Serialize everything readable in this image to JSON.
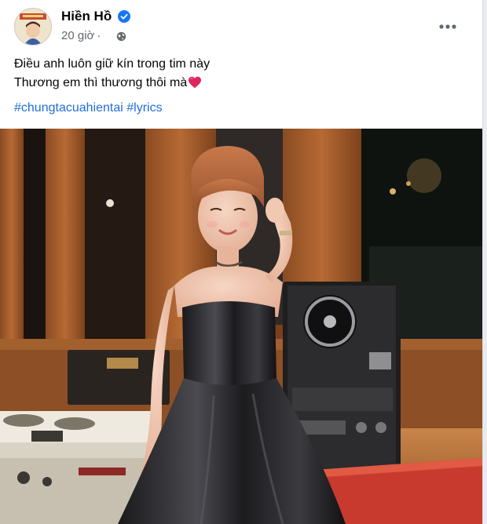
{
  "post": {
    "author": "Hiền Hồ",
    "time": "20 giờ",
    "separator": "·",
    "caption_line1": "Điều anh luôn giữ kín trong tim này",
    "caption_line2": "Thương em thì thương thôi mà",
    "hashtags": [
      "#chungtacuahientai",
      "#lyrics"
    ]
  },
  "icons": {
    "verified": "verified-badge-icon",
    "audience": "globe-icon",
    "more": "more-options-icon",
    "heart": "red-heart-emoji"
  },
  "colors": {
    "link": "#216fdb",
    "verified": "#1877f2",
    "heart": "#e0245e",
    "meta": "#65676b"
  }
}
